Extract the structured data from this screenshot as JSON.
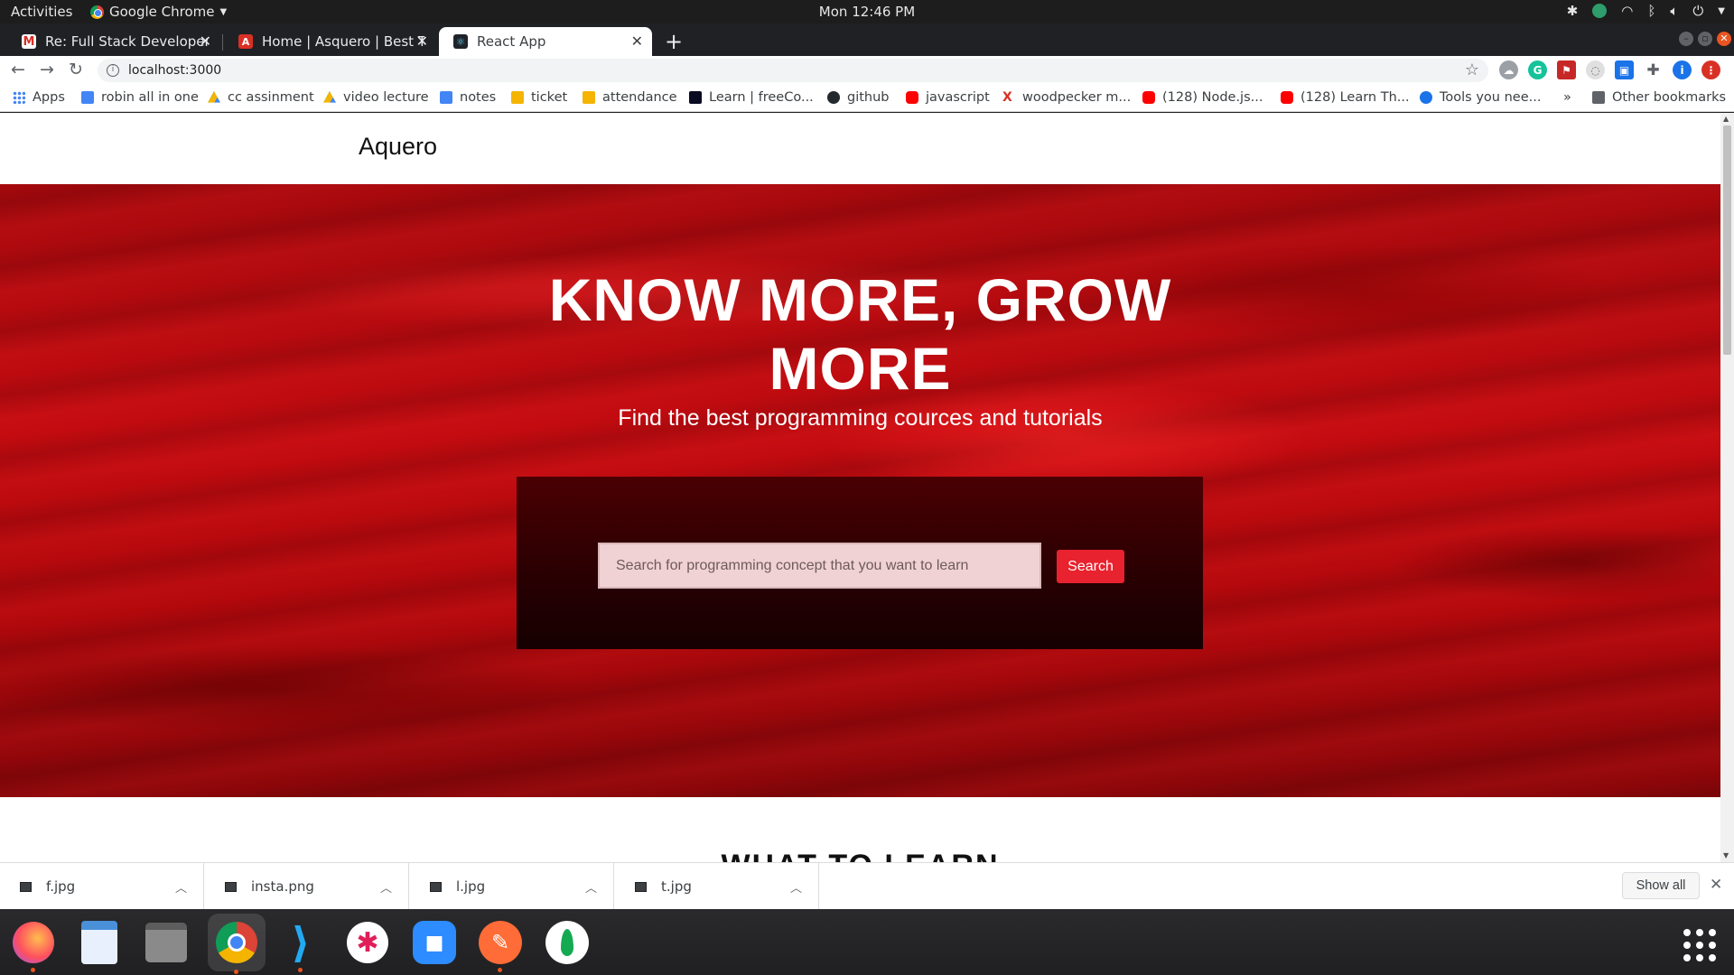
{
  "system_bar": {
    "activities": "Activities",
    "app_name": "Google Chrome",
    "clock": "Mon 12:46 PM"
  },
  "browser": {
    "tabs": [
      {
        "title": "Re: Full Stack Developer -",
        "favicon": "gmail-icon",
        "active": false
      },
      {
        "title": "Home | Asquero | Best Tut",
        "favicon": "asquero-icon",
        "active": false
      },
      {
        "title": "React App",
        "favicon": "react-icon",
        "active": true
      }
    ],
    "url": "localhost:3000",
    "bookmarks": [
      {
        "label": "Apps",
        "icon": "apps-grid-icon"
      },
      {
        "label": "robin all in one",
        "icon": "docs-icon"
      },
      {
        "label": "cc assinment",
        "icon": "drive-icon"
      },
      {
        "label": "video lecture",
        "icon": "drive-icon"
      },
      {
        "label": "notes",
        "icon": "docs-icon"
      },
      {
        "label": "ticket",
        "icon": "slides-icon"
      },
      {
        "label": "attendance",
        "icon": "slides-icon"
      },
      {
        "label": "Learn | freeCo...",
        "icon": "freecodecamp-icon"
      },
      {
        "label": "github",
        "icon": "github-icon"
      },
      {
        "label": "javascript",
        "icon": "youtube-icon"
      },
      {
        "label": "woodpecker m...",
        "icon": "x-icon"
      },
      {
        "label": "(128) Node.js...",
        "icon": "youtube-icon"
      },
      {
        "label": "(128) Learn Th...",
        "icon": "youtube-icon"
      },
      {
        "label": "Tools you nee...",
        "icon": "blue-check-icon"
      }
    ],
    "bookmarks_overflow": "»",
    "other_bookmarks": "Other bookmarks"
  },
  "site": {
    "brand": "Aquero",
    "hero_title_line1": "KNOW MORE, GROW",
    "hero_title_line2": "MORE",
    "hero_subtitle": "Find the best programming cources and tutorials",
    "search_placeholder": "Search for programming concept that you want to learn",
    "search_button": "Search",
    "section_title": "WHAT TO LEARN"
  },
  "downloads": {
    "items": [
      "f.jpg",
      "insta.png",
      "l.jpg",
      "t.jpg"
    ],
    "show_all": "Show all"
  },
  "colors": {
    "hero_red": "#c30b10",
    "search_button": "#e8222e",
    "panel_dark": "#2a0002"
  }
}
